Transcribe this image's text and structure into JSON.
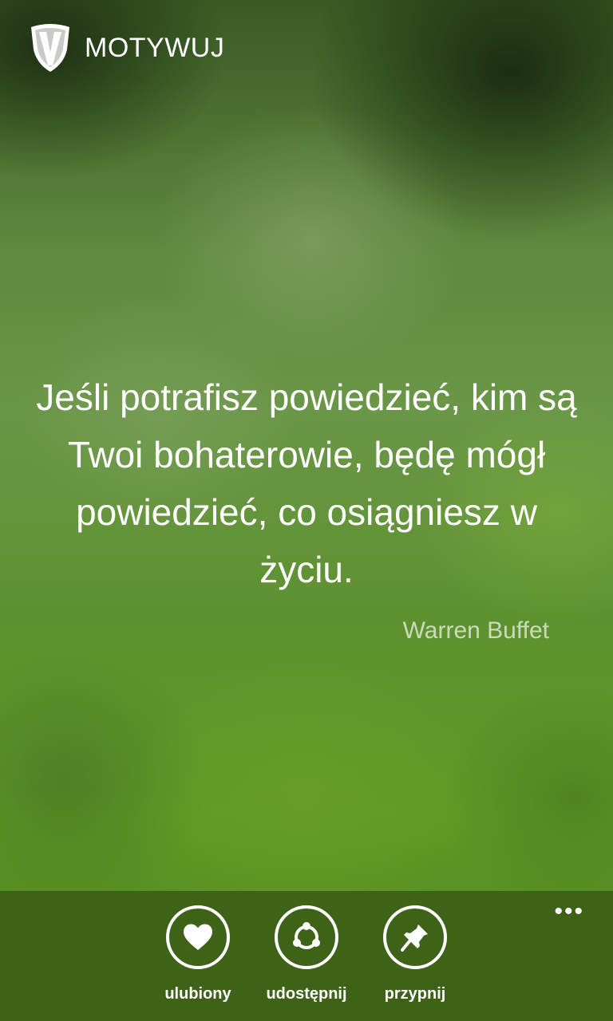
{
  "app": {
    "title": "MOTYWUJ",
    "logo_icon": "shield-logo-icon"
  },
  "quote": {
    "text": "Jeśli potrafisz powiedzieć, kim są Twoi bohaterowie, będę mógł powiedzieć, co osiągniesz w życiu.",
    "author": "Warren Buffet"
  },
  "app_bar": {
    "more_label": "•••",
    "actions": [
      {
        "label": "ulubiony",
        "icon": "heart-icon"
      },
      {
        "label": "udostępnij",
        "icon": "share-icon"
      },
      {
        "label": "przypnij",
        "icon": "pin-icon"
      }
    ]
  },
  "colors": {
    "app_bar_background": "#3e6218",
    "foreground": "#ffffff",
    "author_text": "#dfe6d6"
  }
}
